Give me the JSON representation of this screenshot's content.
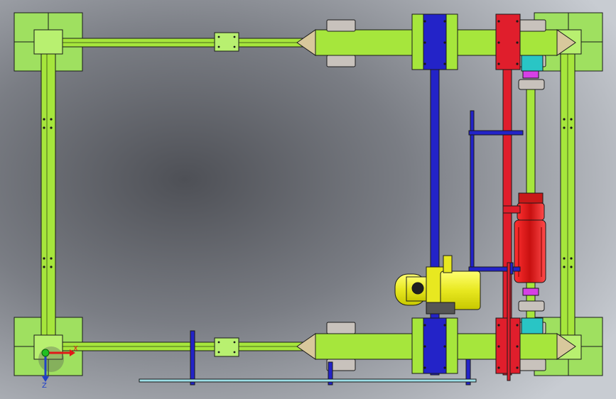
{
  "scene": {
    "colors": {
      "frame_green": "#a6e63c",
      "frame_green_dark": "#79b325",
      "pad_green": "#9fe060",
      "blue_beam": "#2323c8",
      "red_beam": "#e01e2c",
      "motor_red": "#d81818",
      "motor_yellow": "#f3f31e",
      "bearing_tan": "#d8c89c",
      "wheel_grey": "#c8c2bc",
      "coupling_cyan": "#29c5c5",
      "coupling_magenta": "#d640e6",
      "outline": "#1a1a1a"
    },
    "triad": {
      "x_label": "X",
      "y_label": "Z"
    }
  }
}
